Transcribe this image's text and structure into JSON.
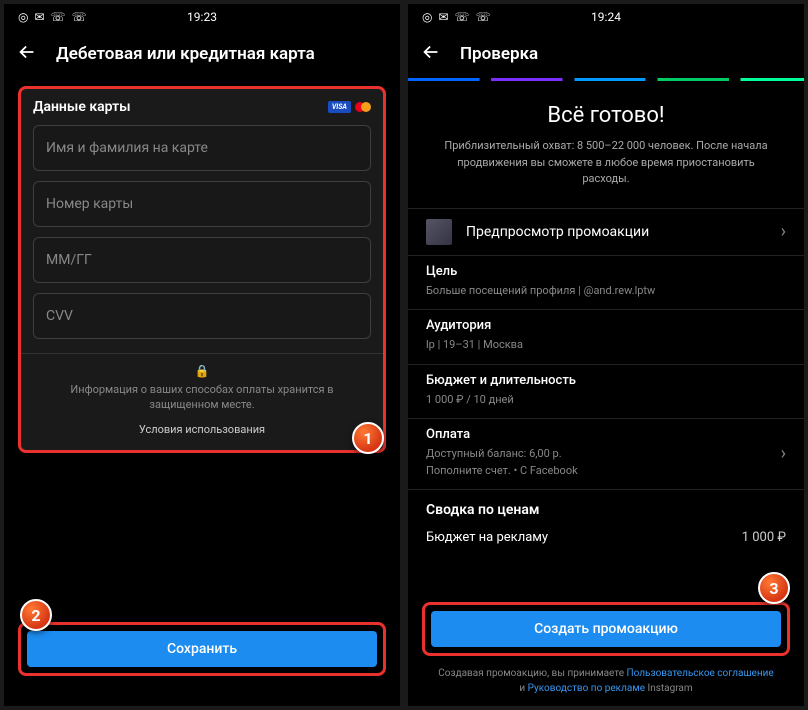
{
  "left": {
    "status_time": "19:23",
    "title": "Дебетовая или кредитная карта",
    "card": {
      "section_title": "Данные карты",
      "visa": "VISA",
      "fields": {
        "name": "Имя и фамилия на карте",
        "number": "Номер карты",
        "expiry": "ММ/ГГ",
        "cvv": "CVV"
      },
      "lock_info": "Информация о ваших способах оплаты хранится в защищенном месте.",
      "terms": "Условия использования"
    },
    "save_btn": "Сохранить"
  },
  "right": {
    "status_time": "19:24",
    "title": "Проверка",
    "ready": {
      "heading": "Всё готово!",
      "sub": "Приблизительный охват: 8 500–22 000 человек. После начала продвижения вы сможете в любое время приостановить расходы."
    },
    "preview_label": "Предпросмотр промоакции",
    "goal": {
      "title": "Цель",
      "sub": "Больше посещений профиля | @and.rew.lptw"
    },
    "audience": {
      "title": "Аудитория",
      "sub": "lp | 19–31 | Москва"
    },
    "budget": {
      "title": "Бюджет и длительность",
      "sub": "1 000 ₽ / 10 дней"
    },
    "payment": {
      "title": "Оплата",
      "sub1": "Доступный баланс: 6,00 р.",
      "sub2": "Пополните счет. • С Facebook"
    },
    "summary": {
      "head": "Сводка по ценам",
      "row_label": "Бюджет на рекламу",
      "row_value": "1 000 ₽"
    },
    "create_btn": "Создать промоакцию",
    "legal": {
      "t1": "Создавая промоакцию, вы принимаете ",
      "link1": "Пользовательское соглашение",
      "t2": " и ",
      "link2": "Руководство по рекламе",
      "t3": " Instagram"
    }
  },
  "markers": {
    "m1": "1",
    "m2": "2",
    "m3": "3"
  }
}
